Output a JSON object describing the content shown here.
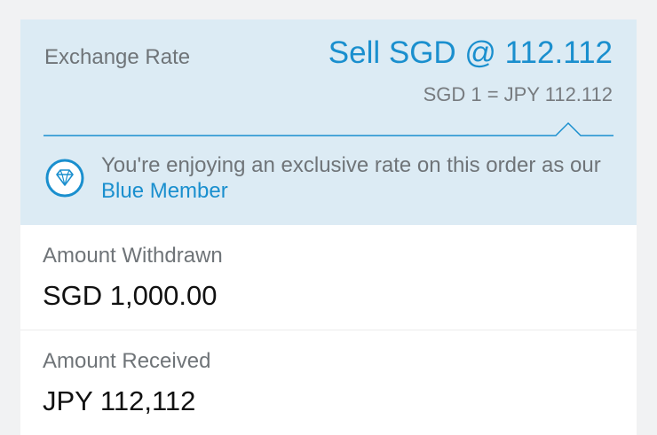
{
  "exchange": {
    "label": "Exchange Rate",
    "sell_rate": "Sell SGD @ 112.112",
    "conversion": "SGD 1 = JPY 112.112"
  },
  "member_notice": {
    "text_prefix": "You're enjoying an exclusive rate on this order as our ",
    "link": "Blue Member",
    "icon": "diamond-icon"
  },
  "withdrawn": {
    "label": "Amount Withdrawn",
    "value": "SGD 1,000.00"
  },
  "received": {
    "label": "Amount Received",
    "value": "JPY 112,112"
  },
  "colors": {
    "accent": "#1a8fce",
    "panel_bg": "#dcebf4",
    "page_bg": "#f1f2f3"
  }
}
